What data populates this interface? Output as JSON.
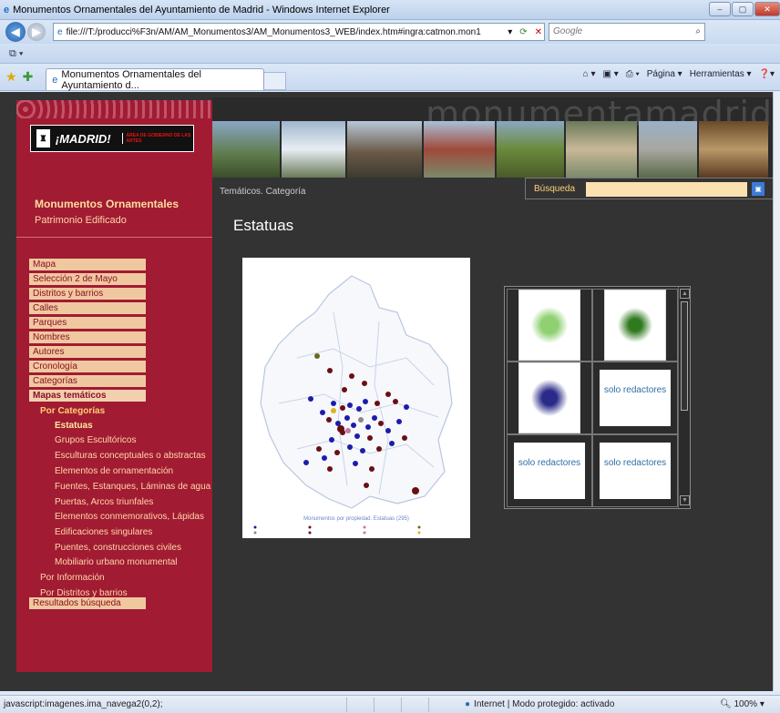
{
  "window": {
    "title": "Monumentos Ornamentales del Ayuntamiento de Madrid - Windows Internet Explorer",
    "minimize": "–",
    "maximize": "▢",
    "close": "✕"
  },
  "address": {
    "url": "file:///T:/producci%F3n/AM/AM_Monumentos3/AM_Monumentos3_WEB/index.htm#ingra:catmon.mon1",
    "search_placeholder": "Google",
    "dropdown": "▾",
    "refresh": "⟳",
    "stop": "✕"
  },
  "tabbar": {
    "tab_title": "Monumentos Ornamentales del Ayuntamiento d...",
    "cmd_page": "Página ▾",
    "cmd_tools": "Herramientas ▾"
  },
  "sidebar": {
    "logo_text": "¡MADRID!",
    "logo_area": "ÁREA DE GOBIERNO DE LAS ARTES",
    "title": "Monumentos Ornamentales",
    "subtitle": "Patrimonio Edificado",
    "menu": [
      "Mapa",
      "Selección 2 de Mayo",
      "Distritos y barrios",
      "Calles",
      "Parques",
      "Nombres",
      "Autores",
      "Cronología",
      "Categorías",
      "Mapas temáticos"
    ],
    "submenu_header": "Por Categorías",
    "submenu": [
      "Estatuas",
      "Grupos Escultóricos",
      "Esculturas conceptuales o abstractas",
      "Elementos de ornamentación",
      "Fuentes, Estanques, Láminas de agua",
      "Puertas, Arcos triunfales",
      "Elementos conmemorativos, Lápidas",
      "Edificaciones singulares",
      "Puentes, construcciones civiles",
      "Mobiliario urbano monumental"
    ],
    "other": [
      "Por Información",
      "Por Distritos y barrios"
    ],
    "results": "Resultados búsqueda"
  },
  "banner": {
    "wordmark": "monumentamadrid"
  },
  "main": {
    "breadcrumb": "Temáticos. Categoría",
    "search_label": "Búsqueda",
    "page_title": "Estatuas",
    "map_caption": "Monumentos por propiedad. Estatuas (295)"
  },
  "gallery": {
    "solo": [
      "solo redactores",
      "solo redactores",
      "solo redactores"
    ]
  },
  "status": {
    "left": "javascript:imagenes.ima_navega2(0,2);",
    "zone": "Internet | Modo protegido: activado",
    "zoom": "100%"
  },
  "colors": {
    "sidebar": "#a11b33",
    "menu_bg": "#f0c8a0",
    "content_bg": "#333333",
    "accent": "#ffd07a"
  }
}
